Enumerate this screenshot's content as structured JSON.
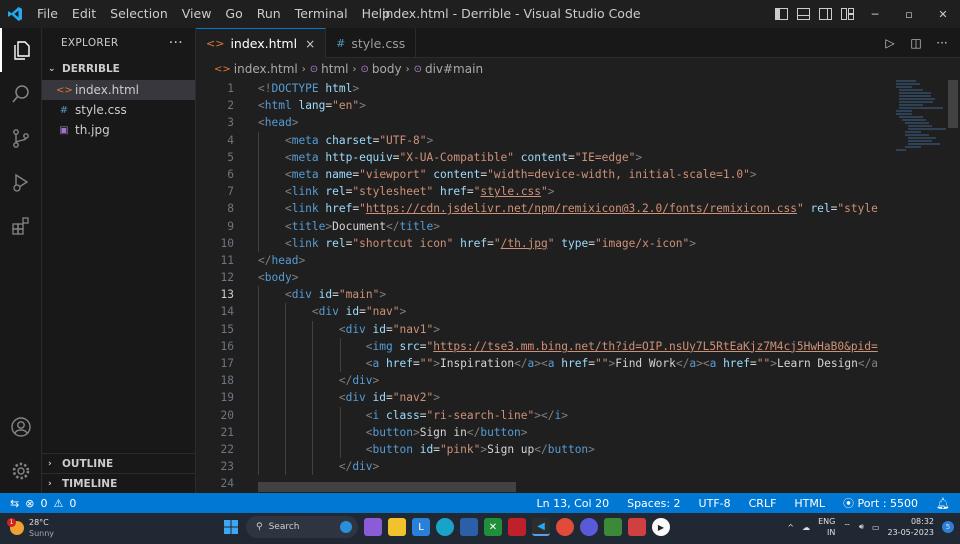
{
  "window": {
    "title": "index.html - Derrible - Visual Studio Code",
    "menu": [
      "File",
      "Edit",
      "Selection",
      "View",
      "Go",
      "Run",
      "Terminal",
      "Help"
    ]
  },
  "explorer": {
    "header": "EXPLORER",
    "more": "···",
    "folder": "DERRIBLE",
    "files": [
      {
        "name": "index.html",
        "icon": "html-file-icon",
        "glyph": "<>",
        "color": "#e37933"
      },
      {
        "name": "style.css",
        "icon": "css-file-icon",
        "glyph": "#",
        "color": "#519aba"
      },
      {
        "name": "th.jpg",
        "icon": "image-file-icon",
        "glyph": "▣",
        "color": "#a074c4"
      }
    ],
    "outline": "OUTLINE",
    "timeline": "TIMELINE"
  },
  "tabs": [
    {
      "label": "index.html",
      "glyph": "<>",
      "color": "#e37933",
      "close": "×"
    },
    {
      "label": "style.css",
      "glyph": "#",
      "color": "#519aba"
    }
  ],
  "breadcrumb": [
    "index.html",
    "html",
    "body",
    "div#main"
  ],
  "code": {
    "current_line": 13,
    "lines": [
      {
        "n": 1,
        "indent": 0,
        "parts": [
          [
            "t",
            "<!"
          ],
          [
            "tag",
            "DOCTYPE"
          ],
          [
            "txt",
            " "
          ],
          [
            "attr",
            "html"
          ],
          [
            "t",
            ">"
          ]
        ]
      },
      {
        "n": 2,
        "indent": 0,
        "parts": [
          [
            "t",
            "<"
          ],
          [
            "tag",
            "html"
          ],
          [
            "txt",
            " "
          ],
          [
            "attr",
            "lang"
          ],
          [
            "txt",
            "="
          ],
          [
            "val",
            "\"en\""
          ],
          [
            "t",
            ">"
          ]
        ]
      },
      {
        "n": 3,
        "indent": 0,
        "parts": [
          [
            "t",
            "<"
          ],
          [
            "tag",
            "head"
          ],
          [
            "t",
            ">"
          ]
        ]
      },
      {
        "n": 4,
        "indent": 1,
        "parts": [
          [
            "t",
            "<"
          ],
          [
            "tag",
            "meta"
          ],
          [
            "txt",
            " "
          ],
          [
            "attr",
            "charset"
          ],
          [
            "txt",
            "="
          ],
          [
            "val",
            "\"UTF-8\""
          ],
          [
            "t",
            ">"
          ]
        ]
      },
      {
        "n": 5,
        "indent": 1,
        "parts": [
          [
            "t",
            "<"
          ],
          [
            "tag",
            "meta"
          ],
          [
            "txt",
            " "
          ],
          [
            "attr",
            "http-equiv"
          ],
          [
            "txt",
            "="
          ],
          [
            "val",
            "\"X-UA-Compatible\""
          ],
          [
            "txt",
            " "
          ],
          [
            "attr",
            "content"
          ],
          [
            "txt",
            "="
          ],
          [
            "val",
            "\"IE=edge\""
          ],
          [
            "t",
            ">"
          ]
        ]
      },
      {
        "n": 6,
        "indent": 1,
        "parts": [
          [
            "t",
            "<"
          ],
          [
            "tag",
            "meta"
          ],
          [
            "txt",
            " "
          ],
          [
            "attr",
            "name"
          ],
          [
            "txt",
            "="
          ],
          [
            "val",
            "\"viewport\""
          ],
          [
            "txt",
            " "
          ],
          [
            "attr",
            "content"
          ],
          [
            "txt",
            "="
          ],
          [
            "val",
            "\"width=device-width, initial-scale=1.0\""
          ],
          [
            "t",
            ">"
          ]
        ]
      },
      {
        "n": 7,
        "indent": 1,
        "parts": [
          [
            "t",
            "<"
          ],
          [
            "tag",
            "link"
          ],
          [
            "txt",
            " "
          ],
          [
            "attr",
            "rel"
          ],
          [
            "txt",
            "="
          ],
          [
            "val",
            "\"stylesheet\""
          ],
          [
            "txt",
            " "
          ],
          [
            "attr",
            "href"
          ],
          [
            "txt",
            "="
          ],
          [
            "val",
            "\""
          ],
          [
            "vallink",
            "style.css"
          ],
          [
            "val",
            "\""
          ],
          [
            "t",
            ">"
          ]
        ]
      },
      {
        "n": 8,
        "indent": 1,
        "parts": [
          [
            "t",
            "<"
          ],
          [
            "tag",
            "link"
          ],
          [
            "txt",
            " "
          ],
          [
            "attr",
            "href"
          ],
          [
            "txt",
            "="
          ],
          [
            "val",
            "\""
          ],
          [
            "vallink",
            "https://cdn.jsdelivr.net/npm/remixicon@3.2.0/fonts/remixicon.css"
          ],
          [
            "val",
            "\""
          ],
          [
            "txt",
            " "
          ],
          [
            "attr",
            "rel"
          ],
          [
            "txt",
            "="
          ],
          [
            "val",
            "\"style"
          ]
        ]
      },
      {
        "n": 9,
        "indent": 1,
        "parts": [
          [
            "t",
            "<"
          ],
          [
            "tag",
            "title"
          ],
          [
            "t",
            ">"
          ],
          [
            "txt",
            "Document"
          ],
          [
            "t",
            "</"
          ],
          [
            "tag",
            "title"
          ],
          [
            "t",
            ">"
          ]
        ]
      },
      {
        "n": 10,
        "indent": 1,
        "parts": [
          [
            "t",
            "<"
          ],
          [
            "tag",
            "link"
          ],
          [
            "txt",
            " "
          ],
          [
            "attr",
            "rel"
          ],
          [
            "txt",
            "="
          ],
          [
            "val",
            "\"shortcut icon\""
          ],
          [
            "txt",
            " "
          ],
          [
            "attr",
            "href"
          ],
          [
            "txt",
            "="
          ],
          [
            "val",
            "\""
          ],
          [
            "vallink",
            "/th.jpg"
          ],
          [
            "val",
            "\""
          ],
          [
            "txt",
            " "
          ],
          [
            "attr",
            "type"
          ],
          [
            "txt",
            "="
          ],
          [
            "val",
            "\"image/x-icon\""
          ],
          [
            "t",
            ">"
          ]
        ]
      },
      {
        "n": 11,
        "indent": 0,
        "parts": [
          [
            "t",
            "</"
          ],
          [
            "tag",
            "head"
          ],
          [
            "t",
            ">"
          ]
        ]
      },
      {
        "n": 12,
        "indent": 0,
        "parts": [
          [
            "t",
            "<"
          ],
          [
            "tag",
            "body"
          ],
          [
            "t",
            ">"
          ]
        ]
      },
      {
        "n": 13,
        "indent": 1,
        "parts": [
          [
            "t",
            "<"
          ],
          [
            "tag",
            "div"
          ],
          [
            "txt",
            " "
          ],
          [
            "attr",
            "id"
          ],
          [
            "txt",
            "="
          ],
          [
            "val",
            "\"main\""
          ],
          [
            "t",
            ">"
          ]
        ]
      },
      {
        "n": 14,
        "indent": 2,
        "parts": [
          [
            "t",
            "<"
          ],
          [
            "tag",
            "div"
          ],
          [
            "txt",
            " "
          ],
          [
            "attr",
            "id"
          ],
          [
            "txt",
            "="
          ],
          [
            "val",
            "\"nav\""
          ],
          [
            "t",
            ">"
          ]
        ]
      },
      {
        "n": 15,
        "indent": 3,
        "parts": [
          [
            "t",
            "<"
          ],
          [
            "tag",
            "div"
          ],
          [
            "txt",
            " "
          ],
          [
            "attr",
            "id"
          ],
          [
            "txt",
            "="
          ],
          [
            "val",
            "\"nav1\""
          ],
          [
            "t",
            ">"
          ]
        ]
      },
      {
        "n": 16,
        "indent": 4,
        "parts": [
          [
            "t",
            "<"
          ],
          [
            "tag",
            "img"
          ],
          [
            "txt",
            " "
          ],
          [
            "attr",
            "src"
          ],
          [
            "txt",
            "="
          ],
          [
            "val",
            "\""
          ],
          [
            "vallink",
            "https://tse3.mm.bing.net/th?id=OIP.nsUy7L5RtEaKjz7M4cj5HwHaB0&pid="
          ]
        ]
      },
      {
        "n": 17,
        "indent": 4,
        "parts": [
          [
            "t",
            "<"
          ],
          [
            "tag",
            "a"
          ],
          [
            "txt",
            " "
          ],
          [
            "attr",
            "href"
          ],
          [
            "txt",
            "="
          ],
          [
            "val",
            "\"\""
          ],
          [
            "t",
            ">"
          ],
          [
            "txt",
            "Inspiration"
          ],
          [
            "t",
            "</"
          ],
          [
            "tag",
            "a"
          ],
          [
            "t",
            "><"
          ],
          [
            "tag",
            "a"
          ],
          [
            "txt",
            " "
          ],
          [
            "attr",
            "href"
          ],
          [
            "txt",
            "="
          ],
          [
            "val",
            "\"\""
          ],
          [
            "t",
            ">"
          ],
          [
            "txt",
            "Find Work"
          ],
          [
            "t",
            "</"
          ],
          [
            "tag",
            "a"
          ],
          [
            "t",
            "><"
          ],
          [
            "tag",
            "a"
          ],
          [
            "txt",
            " "
          ],
          [
            "attr",
            "href"
          ],
          [
            "txt",
            "="
          ],
          [
            "val",
            "\"\""
          ],
          [
            "t",
            ">"
          ],
          [
            "txt",
            "Learn Design"
          ],
          [
            "t",
            "</a"
          ]
        ]
      },
      {
        "n": 18,
        "indent": 3,
        "parts": [
          [
            "t",
            "</"
          ],
          [
            "tag",
            "div"
          ],
          [
            "t",
            ">"
          ]
        ]
      },
      {
        "n": 19,
        "indent": 3,
        "parts": [
          [
            "t",
            "<"
          ],
          [
            "tag",
            "div"
          ],
          [
            "txt",
            " "
          ],
          [
            "attr",
            "id"
          ],
          [
            "txt",
            "="
          ],
          [
            "val",
            "\"nav2\""
          ],
          [
            "t",
            ">"
          ]
        ]
      },
      {
        "n": 20,
        "indent": 4,
        "parts": [
          [
            "t",
            "<"
          ],
          [
            "tag",
            "i"
          ],
          [
            "txt",
            " "
          ],
          [
            "attr",
            "class"
          ],
          [
            "txt",
            "="
          ],
          [
            "val",
            "\"ri-search-line\""
          ],
          [
            "t",
            "></"
          ],
          [
            "tag",
            "i"
          ],
          [
            "t",
            ">"
          ]
        ]
      },
      {
        "n": 21,
        "indent": 4,
        "parts": [
          [
            "t",
            "<"
          ],
          [
            "tag",
            "button"
          ],
          [
            "t",
            ">"
          ],
          [
            "txt",
            "Sign in"
          ],
          [
            "t",
            "</"
          ],
          [
            "tag",
            "button"
          ],
          [
            "t",
            ">"
          ]
        ]
      },
      {
        "n": 22,
        "indent": 4,
        "parts": [
          [
            "t",
            "<"
          ],
          [
            "tag",
            "button"
          ],
          [
            "txt",
            " "
          ],
          [
            "attr",
            "id"
          ],
          [
            "txt",
            "="
          ],
          [
            "val",
            "\"pink\""
          ],
          [
            "t",
            ">"
          ],
          [
            "txt",
            "Sign up"
          ],
          [
            "t",
            "</"
          ],
          [
            "tag",
            "button"
          ],
          [
            "t",
            ">"
          ]
        ]
      },
      {
        "n": 23,
        "indent": 3,
        "parts": [
          [
            "t",
            "</"
          ],
          [
            "tag",
            "div"
          ],
          [
            "t",
            ">"
          ]
        ]
      },
      {
        "n": 24,
        "indent": 0,
        "parts": []
      }
    ]
  },
  "status": {
    "errors": "0",
    "warnings": "0",
    "position": "Ln 13, Col 20",
    "spaces": "Spaces: 2",
    "encoding": "UTF-8",
    "eol": "CRLF",
    "language": "HTML",
    "port": "Port : 5500"
  },
  "taskbar": {
    "temp": "28°C",
    "weather": "Sunny",
    "weather_badge": "1",
    "search": "Search",
    "lang": "ENG",
    "region": "IN",
    "time": "08:32",
    "date": "23-05-2023",
    "notif": "5"
  },
  "colors": {
    "accent": "#0078d4",
    "tag": "#569cd6",
    "attr": "#9cdcfe",
    "string": "#ce9178"
  }
}
